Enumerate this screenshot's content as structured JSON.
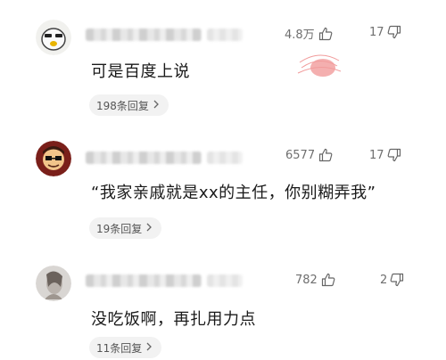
{
  "comments": [
    {
      "likes": "4.8万",
      "dislikes": "17",
      "text": "可是百度上说",
      "replies": "198条回复"
    },
    {
      "likes": "6577",
      "dislikes": "17",
      "text": "“我家亲戚就是xx的主任，你别糊弄我”",
      "replies": "19条回复"
    },
    {
      "likes": "782",
      "dislikes": "2",
      "text": "没吃饭啊，再扎用力点",
      "replies": "11条回复"
    }
  ],
  "icons": {
    "like": "thumbs-up-icon",
    "dislike": "thumbs-down-icon",
    "reply_arrow": "chevron-right-icon"
  },
  "colors": {
    "text": "#1a1a1a",
    "meta": "#6f6f6f",
    "pill_bg": "#f2f2f2",
    "stamp": "#e64a4a"
  }
}
